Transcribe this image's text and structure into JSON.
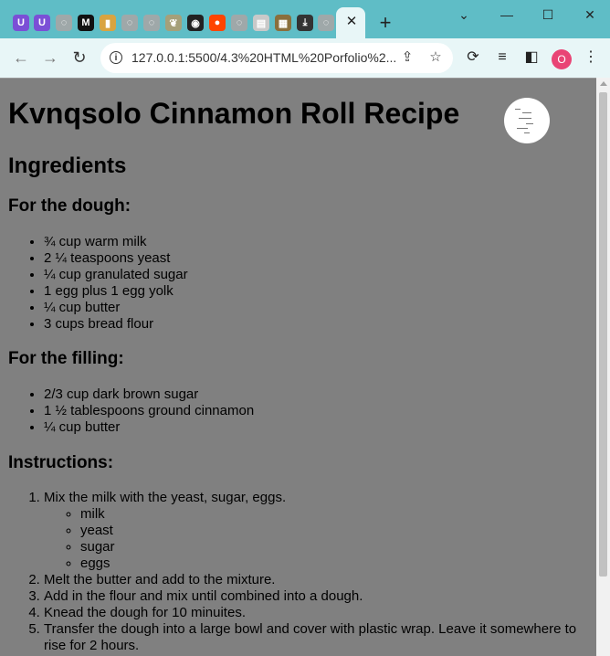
{
  "browser": {
    "tabs": [
      {
        "icon": "u-shield-icon",
        "color": "#7b4fd6",
        "glyph": "U"
      },
      {
        "icon": "u-shield-icon",
        "color": "#7b4fd6",
        "glyph": "U"
      },
      {
        "icon": "globe-icon",
        "color": "#9fa8a9",
        "glyph": "◌"
      },
      {
        "icon": "m-logo-icon",
        "color": "#111111",
        "glyph": "M"
      },
      {
        "icon": "app-icon",
        "color": "#d9a441",
        "glyph": "▮"
      },
      {
        "icon": "globe-icon",
        "color": "#9fa8a9",
        "glyph": "◌"
      },
      {
        "icon": "globe-icon",
        "color": "#9fa8a9",
        "glyph": "◌"
      },
      {
        "icon": "leaf-icon",
        "color": "#a5a07a",
        "glyph": "❦"
      },
      {
        "icon": "github-icon",
        "color": "#222222",
        "glyph": "◉"
      },
      {
        "icon": "reddit-icon",
        "color": "#ff4500",
        "glyph": "●"
      },
      {
        "icon": "globe-icon",
        "color": "#9fa8a9",
        "glyph": "◌"
      },
      {
        "icon": "notes-icon",
        "color": "#c9c9c9",
        "glyph": "▤"
      },
      {
        "icon": "typewriter-icon",
        "color": "#8a6f3c",
        "glyph": "▦"
      },
      {
        "icon": "download-icon",
        "color": "#333333",
        "glyph": "⤓"
      },
      {
        "icon": "globe-icon",
        "color": "#9fa8a9",
        "glyph": "◌"
      }
    ],
    "active_tab_close": "✕",
    "new_tab": "+",
    "url": "127.0.0.1:5500/4.3%20HTML%20Porfolio%2...",
    "profile_initial": "O"
  },
  "page": {
    "title": "Kvnqsolo Cinnamon Roll Recipe",
    "ingredients_heading": "Ingredients",
    "dough_heading": "For the dough:",
    "dough": [
      "¾ cup warm milk",
      "2 ¼ teaspoons yeast",
      "¼ cup granulated sugar",
      "1 egg plus 1 egg yolk",
      "¼ cup butter",
      "3 cups bread flour"
    ],
    "filling_heading": "For the filling:",
    "filling": [
      "2/3 cup dark brown sugar",
      "1 ½ tablespoons ground cinnamon",
      "¼ cup butter"
    ],
    "instructions_heading": "Instructions:",
    "step1": "Mix the milk with the yeast, sugar, eggs.",
    "step1_sub": [
      "milk",
      "yeast",
      "sugar",
      "eggs"
    ],
    "steps": [
      "Melt the butter and add to the mixture.",
      "Add in the flour and mix until combined into a dough.",
      "Knead the dough for 10 minuites.",
      "Transfer the dough into a large bowl and cover with plastic wrap. Leave it somewhere to rise for 2 hours."
    ]
  }
}
